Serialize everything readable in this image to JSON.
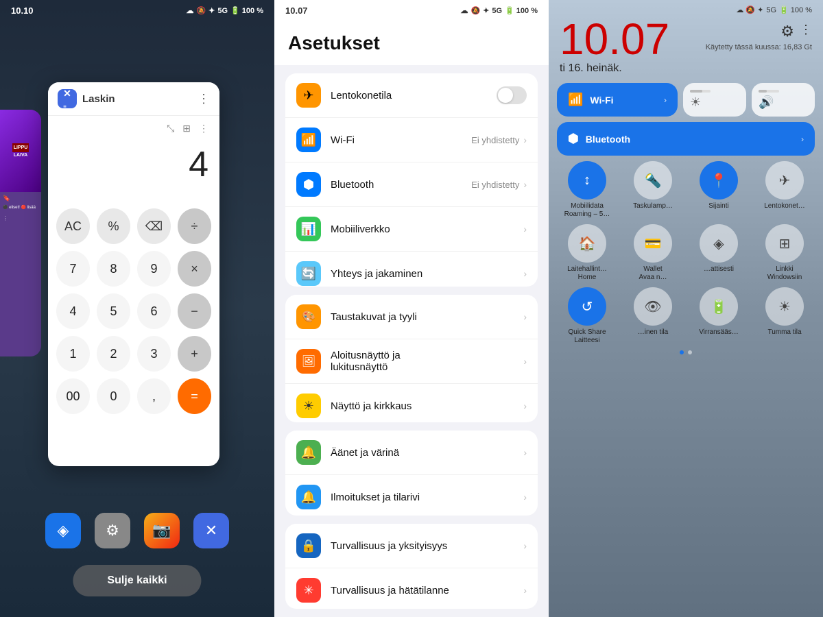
{
  "panel1": {
    "time": "10.10",
    "app_title": "Laskin",
    "calc_display": "4",
    "calc_buttons": [
      [
        "AC",
        "%",
        "⌫",
        "÷"
      ],
      [
        "7",
        "8",
        "9",
        "×"
      ],
      [
        "4",
        "5",
        "6",
        "−"
      ],
      [
        "1",
        "2",
        "3",
        "+"
      ],
      [
        "00",
        "0",
        ",",
        "="
      ]
    ],
    "close_all": "Sulje kaikki",
    "lippu_text": "LIPPU\nLAIVA"
  },
  "panel2": {
    "time": "10.07",
    "title": "Asetukset",
    "groups": [
      {
        "items": [
          {
            "label": "Lentokonetila",
            "icon": "✈",
            "icon_class": "icon-orange",
            "type": "toggle"
          },
          {
            "label": "Wi-Fi",
            "icon": "📶",
            "icon_class": "icon-blue",
            "value": "Ei yhdistetty",
            "type": "arrow"
          },
          {
            "label": "Bluetooth",
            "icon": "🔷",
            "icon_class": "icon-bluetooth",
            "value": "Ei yhdistetty",
            "type": "arrow"
          },
          {
            "label": "Mobiiliverkko",
            "icon": "📊",
            "icon_class": "icon-green",
            "type": "arrow"
          },
          {
            "label": "Yhteys ja jakaminen",
            "icon": "🔄",
            "icon_class": "icon-teal",
            "type": "arrow"
          }
        ]
      },
      {
        "items": [
          {
            "label": "Taustakuvat ja tyyli",
            "icon": "🎨",
            "icon_class": "icon-orange2",
            "type": "arrow"
          },
          {
            "label": "Aloitusnäyttö ja lukitusnäyttö",
            "icon": "🖼",
            "icon_class": "icon-orange3",
            "type": "arrow"
          },
          {
            "label": "Näyttö ja kirkkaus",
            "icon": "☀",
            "icon_class": "icon-yellow",
            "type": "arrow"
          }
        ]
      },
      {
        "items": [
          {
            "label": "Äänet ja värinä",
            "icon": "🔔",
            "icon_class": "icon-green2",
            "type": "arrow"
          },
          {
            "label": "Ilmoitukset ja tilarivi",
            "icon": "🔵",
            "icon_class": "icon-blue2",
            "type": "arrow"
          }
        ]
      },
      {
        "items": [
          {
            "label": "Turvallisuus ja yksityisyys",
            "icon": "🔒",
            "icon_class": "icon-blue3",
            "type": "arrow"
          },
          {
            "label": "Turvallisuus ja hätätilanne",
            "icon": "✳",
            "icon_class": "icon-red",
            "type": "arrow"
          }
        ]
      }
    ]
  },
  "panel3": {
    "time": "10.07",
    "time_color": "#CC0000",
    "date": "ti 16. heinäk.",
    "usage": "Käytetty tässä kuussa: 16,83 Gt",
    "wifi_label": "Wi-Fi",
    "bluetooth_label": "Bluetooth",
    "grid_items": [
      {
        "label": "Mobiilidata\nRoaming – 5…",
        "icon": "↕",
        "active": true
      },
      {
        "label": "Taskulamp…",
        "icon": "🔦",
        "active": false
      },
      {
        "label": "Sijainti",
        "icon": "📍",
        "active": true
      },
      {
        "label": "Lentokonet…",
        "icon": "✈",
        "active": false
      },
      {
        "label": "Laitehallint…\nHome",
        "icon": "🏠",
        "active": false
      },
      {
        "label": "Wallet\nAvaa n…",
        "icon": "💳",
        "active": false
      },
      {
        "label": "…attisesti",
        "icon": "◈",
        "active": false
      },
      {
        "label": "Linkki\nWindowsiin",
        "icon": "⊞",
        "active": false
      },
      {
        "label": "Quick Share\nLaitteesi",
        "icon": "↺",
        "active": true
      },
      {
        "label": "…inen tila",
        "icon": "👁",
        "active": false
      },
      {
        "label": "Virransääs…",
        "icon": "🔋",
        "active": false
      },
      {
        "label": "Tumma tila",
        "icon": "☀",
        "active": false
      }
    ]
  },
  "icons": {
    "wifi": "📶",
    "bluetooth": "🔷",
    "battery": "🔋",
    "signal": "📶"
  }
}
